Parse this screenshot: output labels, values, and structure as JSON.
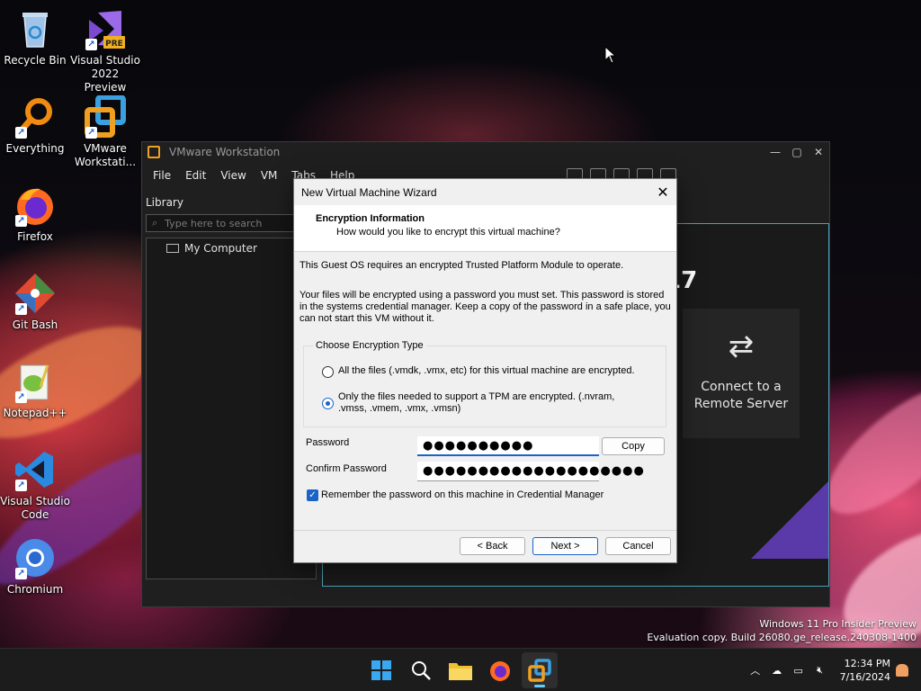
{
  "desktop": {
    "icons": [
      {
        "label": "Recycle Bin"
      },
      {
        "label": "Visual Studio 2022 Preview",
        "badge": "PRE"
      },
      {
        "label": "Everything"
      },
      {
        "label": "VMware Workstati..."
      },
      {
        "label": "Firefox"
      },
      {
        "label": "Git Bash"
      },
      {
        "label": "Notepad++"
      },
      {
        "label": "Visual Studio Code"
      },
      {
        "label": "Chromium"
      }
    ]
  },
  "vmware": {
    "title": "VMware Workstation",
    "menu": [
      "File",
      "Edit",
      "View",
      "VM",
      "Tabs",
      "Help"
    ],
    "library_label": "Library",
    "search_placeholder": "Type here to search",
    "tree_item": "My Computer",
    "home_version": "17",
    "connect_label": "Connect to a Remote Server"
  },
  "dialog": {
    "title": "New Virtual Machine Wizard",
    "heading": "Encryption Information",
    "subheading": "How would you like to encrypt this virtual machine?",
    "intro": "This Guest OS requires an encrypted Trusted Platform Module to operate.",
    "info": "Your files will be encrypted using a password you must set. This password is stored in the systems credential manager. Keep a copy of the password in a safe place, you can not start this VM without it.",
    "group_label": "Choose Encryption Type",
    "option_all": "All the files (.vmdk, .vmx, etc) for this virtual machine are encrypted.",
    "option_tpm": "Only the files needed to support a TPM are encrypted. (.nvram, .vmss, .vmem, .vmx, .vmsn)",
    "selected_option": "tpm",
    "password_label": "Password",
    "password_value": "●●●●●●●●●●",
    "confirm_label": "Confirm Password",
    "confirm_value": "●●●●●●●●●●●●●●●●●●●●",
    "copy_label": "Copy",
    "remember_label": "Remember the password on this machine in Credential Manager",
    "remember_checked": true,
    "back_label": "< Back",
    "next_label": "Next >",
    "cancel_label": "Cancel"
  },
  "watermark": {
    "line1": "Windows 11 Pro Insider Preview",
    "line2": "Evaluation copy. Build 26080.ge_release.240308-1400"
  },
  "taskbar": {
    "time": "12:34 PM",
    "date": "7/16/2024"
  },
  "colors": {
    "accent": "#1a64c8",
    "dialog_bg": "#f0f0f0",
    "vmware_bg": "#1f1f1f"
  }
}
